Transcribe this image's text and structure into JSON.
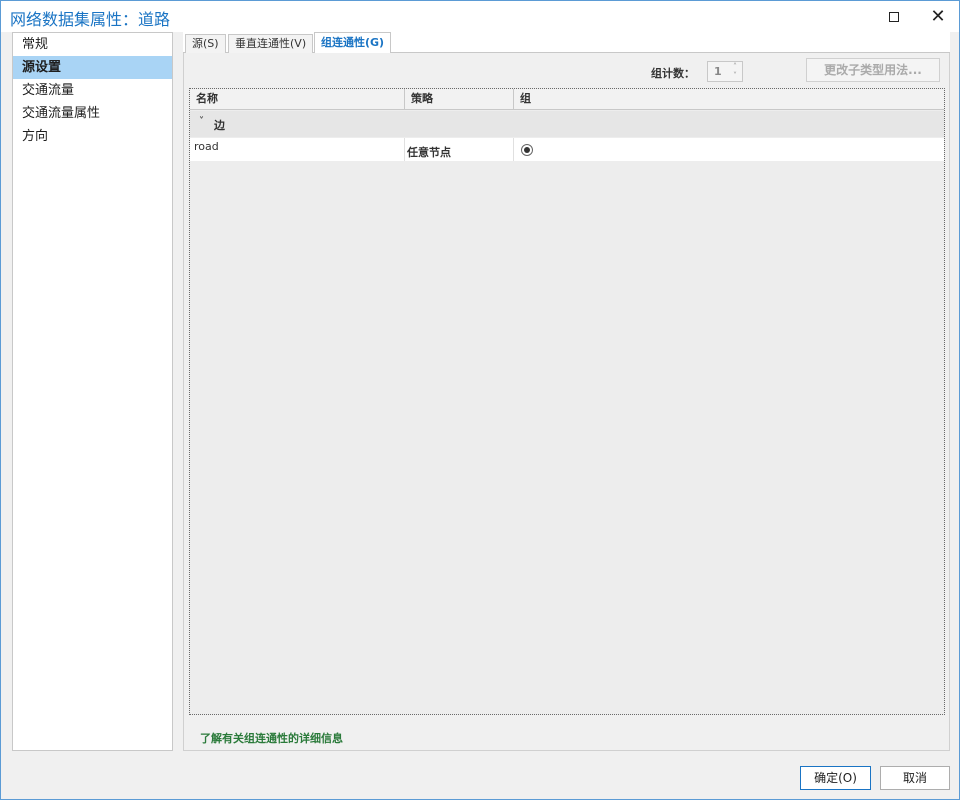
{
  "window": {
    "title": "网络数据集属性：道路",
    "maximize_icon": "maximize-icon",
    "close_icon": "close-icon"
  },
  "sidebar": {
    "items": [
      {
        "label": "常规",
        "active": false
      },
      {
        "label": "源设置",
        "active": true
      },
      {
        "label": "交通流量",
        "active": false
      },
      {
        "label": "交通流量属性",
        "active": false
      },
      {
        "label": "方向",
        "active": false
      }
    ]
  },
  "tabs": [
    {
      "label": "源(S)",
      "active": false
    },
    {
      "label": "垂直连通性(V)",
      "active": false
    },
    {
      "label": "组连通性(G)",
      "active": true
    }
  ],
  "toolbar": {
    "group_count_label": "组计数：",
    "group_count_value": "1",
    "change_subtype_label": "更改子类型用法..."
  },
  "grid": {
    "columns": [
      "名称",
      "策略",
      "组"
    ],
    "group_label": "边",
    "rows": [
      {
        "name": "road",
        "strategy": "任意节点",
        "group_selected": true
      }
    ]
  },
  "info_link": "了解有关组连通性的详细信息",
  "footer": {
    "ok_label": "确定(O)",
    "cancel_label": "取消"
  },
  "colors": {
    "accent": "#1a74c4",
    "active_nav": "#a9d4f5",
    "link": "#2a7a3a"
  }
}
